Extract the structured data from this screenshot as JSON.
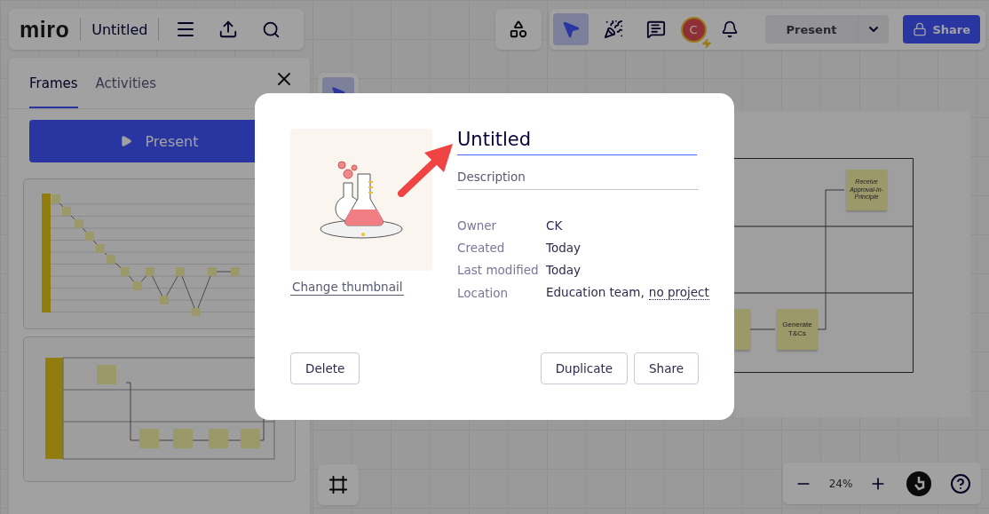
{
  "top_bar": {
    "logo": "miro",
    "board_title": "Untitled"
  },
  "toolbar": {
    "tools": [
      {
        "kind": "select",
        "selected": true
      },
      {
        "kind": "reactions",
        "selected": false
      },
      {
        "kind": "comments",
        "selected": false
      }
    ],
    "avatar": {
      "initial": "C"
    },
    "present_button": "Present",
    "share_button": "Share"
  },
  "side_panel": {
    "tabs": [
      {
        "label": "Frames",
        "selected": true
      },
      {
        "label": "Activities",
        "selected": false
      }
    ],
    "present_button": "Present"
  },
  "board": {
    "stickies": [
      {
        "text": "Receive Approval-in-Principle"
      },
      {
        "text": "Generate T&Cs"
      }
    ]
  },
  "zoom": {
    "value": "24%"
  },
  "dialog": {
    "title_value": "Untitled",
    "description_placeholder": "Description",
    "change_thumbnail": "Change thumbnail",
    "details": [
      {
        "label": "Owner",
        "value": "CK"
      },
      {
        "label": "Created",
        "value": "Today"
      },
      {
        "label": "Last modified",
        "value": "Today"
      },
      {
        "label": "Location",
        "value": "Education team,",
        "link": "no project"
      }
    ],
    "left_buttons": [
      "Delete"
    ],
    "right_buttons": [
      "Duplicate",
      "Share"
    ]
  }
}
